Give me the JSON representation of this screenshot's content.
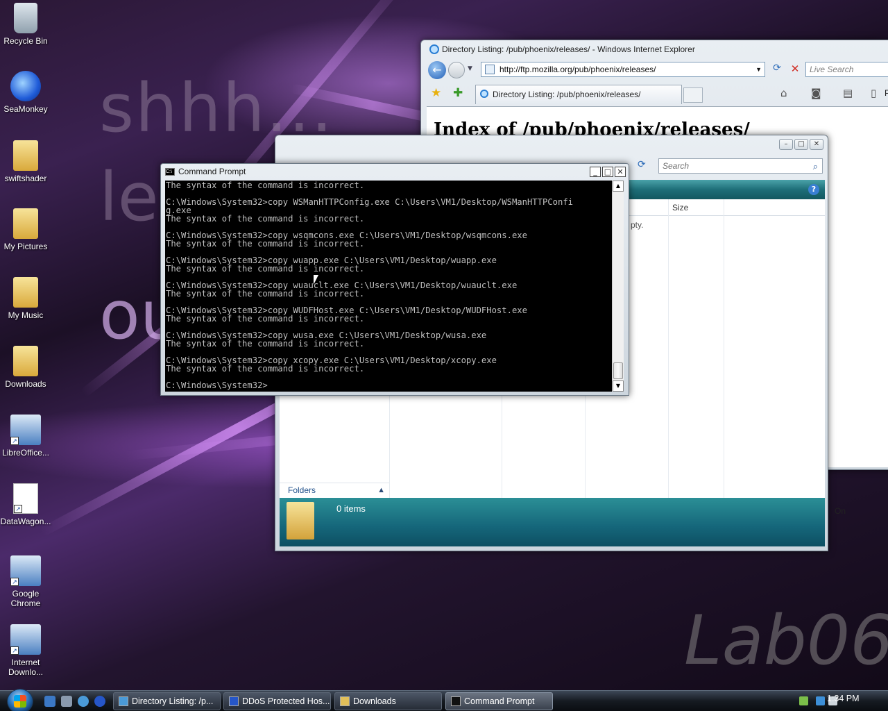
{
  "desktop": {
    "wallpaper_text": [
      "shhh...",
      "let",
      "ou"
    ],
    "watermark": "Lab06",
    "icons": [
      {
        "label": "Recycle Bin"
      },
      {
        "label": "SeaMonkey"
      },
      {
        "label": "swiftshader"
      },
      {
        "label": "My Pictures"
      },
      {
        "label": "My Music"
      },
      {
        "label": "Downloads"
      },
      {
        "label": "LibreOffice..."
      },
      {
        "label": "DataWagon..."
      },
      {
        "label": "Google Chrome"
      },
      {
        "label": "Internet Downlo..."
      }
    ]
  },
  "ie": {
    "title": "Directory Listing: /pub/phoenix/releases/ - Windows Internet Explorer",
    "address": "http://ftp.mozilla.org/pub/phoenix/releases/",
    "search_placeholder": "Live Search",
    "tab_label": "Directory Listing: /pub/phoenix/releases/",
    "toolbar_page_label": "Pa",
    "heading": "Index of /pub/phoenix/releases/",
    "peek_text": "On"
  },
  "explorer": {
    "search_placeholder": "Search",
    "column_size": "Size",
    "empty_text": "pty.",
    "folders_label": "Folders",
    "items_count": "0 items"
  },
  "cmd": {
    "title": "Command Prompt",
    "lines": [
      "The syntax of the command is incorrect.",
      "",
      "C:\\Windows\\System32>copy WSManHTTPConfig.exe C:\\Users\\VM1/Desktop/WSManHTTPConfi",
      "g.exe",
      "The syntax of the command is incorrect.",
      "",
      "C:\\Windows\\System32>copy wsqmcons.exe C:\\Users\\VM1/Desktop/wsqmcons.exe",
      "The syntax of the command is incorrect.",
      "",
      "C:\\Windows\\System32>copy wuapp.exe C:\\Users\\VM1/Desktop/wuapp.exe",
      "The syntax of the command is incorrect.",
      "",
      "C:\\Windows\\System32>copy wuauclt.exe C:\\Users\\VM1/Desktop/wuauclt.exe",
      "The syntax of the command is incorrect.",
      "",
      "C:\\Windows\\System32>copy WUDFHost.exe C:\\Users\\VM1/Desktop/WUDFHost.exe",
      "The syntax of the command is incorrect.",
      "",
      "C:\\Windows\\System32>copy wusa.exe C:\\Users\\VM1/Desktop/wusa.exe",
      "The syntax of the command is incorrect.",
      "",
      "C:\\Windows\\System32>copy xcopy.exe C:\\Users\\VM1/Desktop/xcopy.exe",
      "The syntax of the command is incorrect.",
      "",
      "C:\\Windows\\System32>"
    ]
  },
  "taskbar": {
    "buttons": [
      {
        "label": "Directory Listing: /p...",
        "icon": "ie-icon"
      },
      {
        "label": "DDoS Protected Hos...",
        "icon": "seamonkey-icon"
      },
      {
        "label": "Downloads",
        "icon": "folder-icon"
      },
      {
        "label": "Command Prompt",
        "icon": "cmd-icon"
      }
    ],
    "clock": "1:34 PM"
  }
}
